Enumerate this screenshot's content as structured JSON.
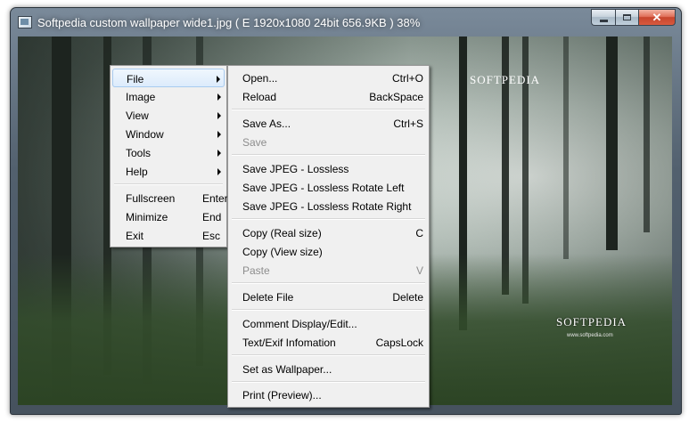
{
  "window": {
    "title": "Softpedia custom wallpaper wide1.jpg  ( E  1920x1080  24bit  656.9KB )  38%"
  },
  "image": {
    "watermark_top": "SOFTPEDIA",
    "watermark_bottom": "SOFTPEDIA",
    "watermark_url": "www.softpedia.com"
  },
  "main_menu": {
    "items": [
      {
        "label": "File",
        "submenu": true,
        "highlighted": true
      },
      {
        "label": "Image",
        "submenu": true
      },
      {
        "label": "View",
        "submenu": true
      },
      {
        "label": "Window",
        "submenu": true
      },
      {
        "label": "Tools",
        "submenu": true
      },
      {
        "label": "Help",
        "submenu": true
      },
      {
        "label": "Fullscreen",
        "shortcut": "Enter"
      },
      {
        "label": "Minimize",
        "shortcut": "End"
      },
      {
        "label": "Exit",
        "shortcut": "Esc"
      }
    ]
  },
  "file_menu": {
    "items": [
      {
        "label": "Open...",
        "shortcut": "Ctrl+O"
      },
      {
        "label": "Reload",
        "shortcut": "BackSpace"
      },
      {
        "label": "Save As...",
        "shortcut": "Ctrl+S"
      },
      {
        "label": "Save",
        "shortcut": "",
        "disabled": true
      },
      {
        "label": "Save JPEG - Lossless",
        "shortcut": ""
      },
      {
        "label": "Save JPEG - Lossless Rotate Left",
        "shortcut": ""
      },
      {
        "label": "Save JPEG - Lossless Rotate Right",
        "shortcut": ""
      },
      {
        "label": "Copy (Real size)",
        "shortcut": "C"
      },
      {
        "label": "Copy (View size)",
        "shortcut": ""
      },
      {
        "label": "Paste",
        "shortcut": "V",
        "disabled": true
      },
      {
        "label": "Delete File",
        "shortcut": "Delete"
      },
      {
        "label": "Comment Display/Edit...",
        "shortcut": ""
      },
      {
        "label": "Text/Exif Infomation",
        "shortcut": "CapsLock"
      },
      {
        "label": "Set as Wallpaper...",
        "shortcut": ""
      },
      {
        "label": "Print (Preview)...",
        "shortcut": ""
      }
    ]
  }
}
